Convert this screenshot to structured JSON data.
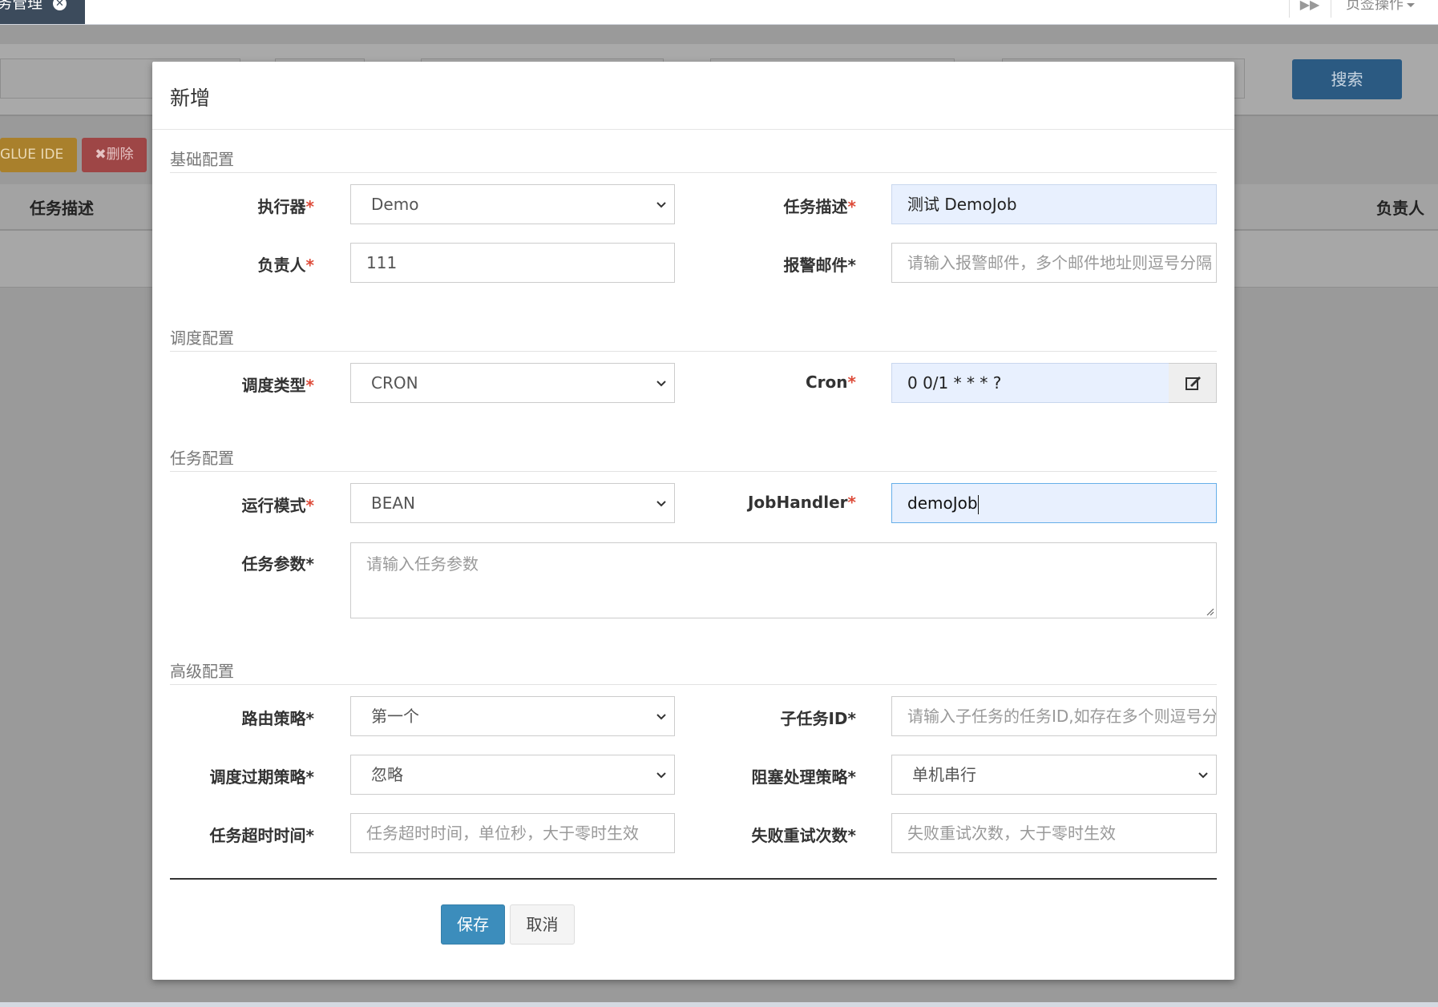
{
  "topbar": {
    "active_tab": "务管理",
    "tab_ops": "页签操作"
  },
  "background": {
    "search_button": "搜索",
    "glue_button": "GLUE IDE",
    "delete_button": "✖删除",
    "columns": [
      "任务描述",
      "负责人"
    ]
  },
  "modal": {
    "title": "新增",
    "sections": {
      "basic": "基础配置",
      "schedule": "调度配置",
      "task": "任务配置",
      "advanced": "高级配置"
    },
    "fields": {
      "executor": {
        "label": "执行器",
        "value": "Demo"
      },
      "job_desc": {
        "label": "任务描述",
        "value": "测试 DemoJob"
      },
      "author": {
        "label": "负责人",
        "value": "111"
      },
      "alarm_email": {
        "label": "报警邮件*",
        "placeholder": "请输入报警邮件，多个邮件地址则逗号分隔"
      },
      "schedule_type": {
        "label": "调度类型",
        "value": "CRON"
      },
      "cron": {
        "label": "Cron",
        "value": "0 0/1 * * * ?"
      },
      "glue_type": {
        "label": "运行模式",
        "value": "BEAN"
      },
      "job_handler": {
        "label": "JobHandler",
        "value": "demoJob"
      },
      "job_param": {
        "label": "任务参数*",
        "placeholder": "请输入任务参数"
      },
      "route_strategy": {
        "label": "路由策略*",
        "value": "第一个"
      },
      "child_job_id": {
        "label": "子任务ID*",
        "placeholder": "请输入子任务的任务ID,如存在多个则逗号分隔"
      },
      "misfire_strategy": {
        "label": "调度过期策略*",
        "value": "忽略"
      },
      "block_strategy": {
        "label": "阻塞处理策略*",
        "value": "单机串行"
      },
      "timeout": {
        "label": "任务超时时间*",
        "placeholder": "任务超时时间，单位秒，大于零时生效"
      },
      "fail_retry": {
        "label": "失败重试次数*",
        "placeholder": "失败重试次数，大于零时生效"
      }
    },
    "buttons": {
      "save": "保存",
      "cancel": "取消"
    }
  },
  "colors": {
    "primary": "#3c8dbc",
    "required": "#dd4b39",
    "focus_bg": "#e8f0fe"
  }
}
